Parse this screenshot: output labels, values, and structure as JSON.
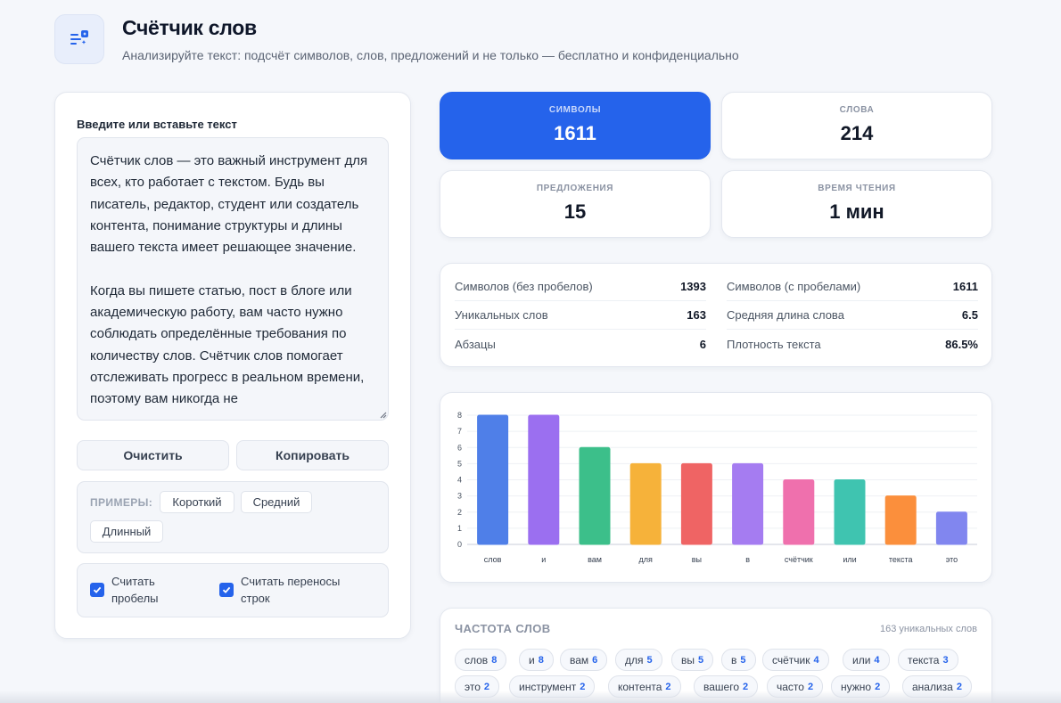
{
  "header": {
    "title": "Счётчик слов",
    "subtitle": "Анализируйте текст: подсчёт символов, слов, предложений и не только — бесплатно и конфиденциально",
    "logo_icon": "text-sparkle-icon"
  },
  "editor": {
    "label": "Введите или вставьте текст",
    "text": "Счётчик слов — это важный инструмент для всех, кто работает с текстом. Будь вы писатель, редактор, студент или создатель контента, понимание структуры и длины вашего текста имеет решающее значение.\n\nКогда вы пишете статью, пост в блоге или академическую работу, вам часто нужно соблюдать определённые требования по количеству слов. Счётчик слов помогает отслеживать прогресс в реальном времени, поэтому вам никогда не"
  },
  "actions": {
    "clear_label": "Очистить",
    "copy_label": "Копировать"
  },
  "examples": {
    "label": "ПРИМЕРЫ:",
    "short": "Короткий",
    "medium": "Средний",
    "long": "Длинный"
  },
  "options": {
    "count_spaces": "Считать пробелы",
    "count_line_breaks": "Считать переносы строк",
    "count_spaces_checked": true,
    "count_line_breaks_checked": true
  },
  "stats": [
    {
      "label": "СИМВОЛЫ",
      "value": "1611"
    },
    {
      "label": "СЛОВА",
      "value": "214"
    },
    {
      "label": "ПРЕДЛОЖЕНИЯ",
      "value": "15"
    },
    {
      "label": "ВРЕМЯ ЧТЕНИЯ",
      "value": "1 мин"
    }
  ],
  "details": [
    {
      "key": "Символов (без пробелов)",
      "value": "1393"
    },
    {
      "key": "Символов (с пробелами)",
      "value": "1611"
    },
    {
      "key": "Уникальных слов",
      "value": "163"
    },
    {
      "key": "Средняя длина слова",
      "value": "6.5"
    },
    {
      "key": "Абзацы",
      "value": "6"
    },
    {
      "key": "Плотность текста",
      "value": "86.5%"
    }
  ],
  "chart_data": {
    "type": "bar",
    "categories": [
      "слов",
      "и",
      "вам",
      "для",
      "вы",
      "в",
      "счётчик",
      "или",
      "текста",
      "это"
    ],
    "values": [
      8,
      8,
      6,
      5,
      5,
      5,
      4,
      4,
      3,
      2
    ],
    "colors": [
      "#4f7fe8",
      "#9b6ff0",
      "#3cbf8a",
      "#f6b23a",
      "#ef6464",
      "#a57cf1",
      "#ef70ad",
      "#3fc4b0",
      "#fb8f3c",
      "#8186ef"
    ],
    "ylim": [
      0,
      8
    ],
    "yticks": [
      "0",
      "1",
      "2",
      "3",
      "4",
      "5",
      "6",
      "7",
      "8"
    ],
    "grid": true,
    "legend": false
  },
  "frequency": {
    "title": "ЧАСТОТА СЛОВ",
    "unique_label": "163 уникальных слов",
    "tags": [
      {
        "word": "слов",
        "count": "8"
      },
      {
        "word": "и",
        "count": "8"
      },
      {
        "word": "вам",
        "count": "6"
      },
      {
        "word": "для",
        "count": "5"
      },
      {
        "word": "вы",
        "count": "5"
      },
      {
        "word": "в",
        "count": "5"
      },
      {
        "word": "счётчик",
        "count": "4"
      },
      {
        "word": "или",
        "count": "4"
      },
      {
        "word": "текста",
        "count": "3"
      },
      {
        "word": "это",
        "count": "2"
      },
      {
        "word": "инструмент",
        "count": "2"
      },
      {
        "word": "контента",
        "count": "2"
      },
      {
        "word": "вашего",
        "count": "2"
      },
      {
        "word": "часто",
        "count": "2"
      },
      {
        "word": "нужно",
        "count": "2"
      },
      {
        "word": "анализа",
        "count": "2"
      }
    ]
  }
}
